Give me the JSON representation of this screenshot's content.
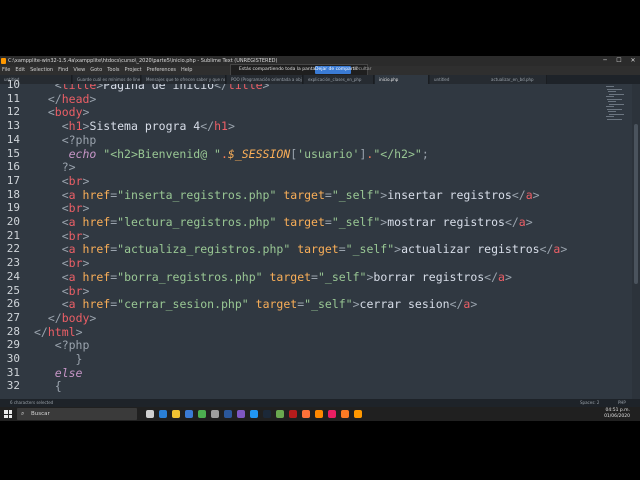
{
  "window": {
    "title": "C:\\xampplite-win32-1.5.4a\\xampplite\\htdocs\\curso\\_2020\\parte5\\inicio.php - Sublime Text (UNREGISTERED)",
    "menu": [
      "File",
      "Edit",
      "Selection",
      "Find",
      "View",
      "Goto",
      "Tools",
      "Project",
      "Preferences",
      "Help"
    ]
  },
  "share_banner": {
    "text": "Estás compartiendo toda la pantalla.",
    "button": "Dejar de compartir",
    "hide": "Ocultar"
  },
  "tabs": [
    {
      "label": "untitled",
      "active": false
    },
    {
      "label": "Guarde cuál es mínimos de línea",
      "active": false
    },
    {
      "label": "Mensajes que te ofrecen saber y que no hacen m",
      "active": false
    },
    {
      "label": "POO (Programación orientada a objetos)",
      "active": false
    },
    {
      "label": "explicación_clases_en_php",
      "active": false
    },
    {
      "label": "inicio.php",
      "active": true
    },
    {
      "label": "untitled",
      "active": false
    },
    {
      "label": "",
      "active": false
    },
    {
      "label": "actualizar_en_bd.php",
      "active": false
    }
  ],
  "editor": {
    "line_numbers": [
      "10",
      "11",
      "12",
      "13",
      "14",
      "15",
      "16",
      "17",
      "18",
      "19",
      "20",
      "21",
      "22",
      "23",
      "24",
      "25",
      "26",
      "27",
      "28",
      "29",
      "30",
      "31",
      "32"
    ],
    "lines": [
      [
        [
          "   ",
          ""
        ],
        [
          "<",
          "br"
        ],
        [
          "title",
          "tag"
        ],
        [
          ">",
          "br"
        ],
        [
          "Página de inicio",
          "txt"
        ],
        [
          "</",
          "br"
        ],
        [
          "title",
          "tag"
        ],
        [
          ">",
          "br"
        ]
      ],
      [
        [
          "  ",
          ""
        ],
        [
          "</",
          "br"
        ],
        [
          "head",
          "tag"
        ],
        [
          ">",
          "br"
        ]
      ],
      [
        [
          "  ",
          ""
        ],
        [
          "<",
          "br"
        ],
        [
          "body",
          "tag"
        ],
        [
          ">",
          "br"
        ]
      ],
      [
        [
          "    ",
          ""
        ],
        [
          "<",
          "br"
        ],
        [
          "h1",
          "tag"
        ],
        [
          ">",
          "br"
        ],
        [
          "Sistema progra 4",
          "txt"
        ],
        [
          "</",
          "br"
        ],
        [
          "h1",
          "tag"
        ],
        [
          ">",
          "br"
        ]
      ],
      [
        [
          "    ",
          ""
        ],
        [
          "<?php",
          "br"
        ]
      ],
      [
        [
          "     ",
          ""
        ],
        [
          "echo",
          "kw"
        ],
        [
          " ",
          ""
        ],
        [
          "\"<h2>Bienvenid@ \"",
          "str"
        ],
        [
          ".",
          "op"
        ],
        [
          "$_SESSION",
          "var"
        ],
        [
          "[",
          "br"
        ],
        [
          "'usuario'",
          "str"
        ],
        [
          "]",
          "br"
        ],
        [
          ".",
          "op"
        ],
        [
          "\"</h2>\"",
          "str"
        ],
        [
          ";",
          "br"
        ]
      ],
      [
        [
          "    ",
          ""
        ],
        [
          "?>",
          "br"
        ]
      ],
      [
        [
          "    ",
          ""
        ],
        [
          "<",
          "br"
        ],
        [
          "br",
          "tag"
        ],
        [
          ">",
          "br"
        ]
      ],
      [
        [
          "    ",
          ""
        ],
        [
          "<",
          "br"
        ],
        [
          "a",
          "tag"
        ],
        [
          " ",
          ""
        ],
        [
          "href",
          "attr"
        ],
        [
          "=",
          "br"
        ],
        [
          "\"inserta_registros.php\"",
          "str"
        ],
        [
          " ",
          ""
        ],
        [
          "target",
          "attr"
        ],
        [
          "=",
          "br"
        ],
        [
          "\"_self\"",
          "str"
        ],
        [
          ">",
          "br"
        ],
        [
          "insertar registros",
          "txt"
        ],
        [
          "</",
          "br"
        ],
        [
          "a",
          "tag"
        ],
        [
          ">",
          "br"
        ]
      ],
      [
        [
          "    ",
          ""
        ],
        [
          "<",
          "br"
        ],
        [
          "br",
          "tag"
        ],
        [
          ">",
          "br"
        ]
      ],
      [
        [
          "    ",
          ""
        ],
        [
          "<",
          "br"
        ],
        [
          "a",
          "tag"
        ],
        [
          " ",
          ""
        ],
        [
          "href",
          "attr"
        ],
        [
          "=",
          "br"
        ],
        [
          "\"lectura_registros.php\"",
          "str"
        ],
        [
          " ",
          ""
        ],
        [
          "target",
          "attr"
        ],
        [
          "=",
          "br"
        ],
        [
          "\"_self\"",
          "str"
        ],
        [
          ">",
          "br"
        ],
        [
          "mostrar registros",
          "txt"
        ],
        [
          "</",
          "br"
        ],
        [
          "a",
          "tag"
        ],
        [
          ">",
          "br"
        ]
      ],
      [
        [
          "    ",
          ""
        ],
        [
          "<",
          "br"
        ],
        [
          "br",
          "tag"
        ],
        [
          ">",
          "br"
        ]
      ],
      [
        [
          "    ",
          ""
        ],
        [
          "<",
          "br"
        ],
        [
          "a",
          "tag"
        ],
        [
          " ",
          ""
        ],
        [
          "href",
          "attr"
        ],
        [
          "=",
          "br"
        ],
        [
          "\"actualiza_registros.php\"",
          "str"
        ],
        [
          " ",
          ""
        ],
        [
          "target",
          "attr"
        ],
        [
          "=",
          "br"
        ],
        [
          "\"_self\"",
          "str"
        ],
        [
          ">",
          "br"
        ],
        [
          "actualizar registros",
          "txt"
        ],
        [
          "</",
          "br"
        ],
        [
          "a",
          "tag"
        ],
        [
          ">",
          "br"
        ]
      ],
      [
        [
          "    ",
          ""
        ],
        [
          "<",
          "br"
        ],
        [
          "br",
          "tag"
        ],
        [
          ">",
          "br"
        ]
      ],
      [
        [
          "    ",
          ""
        ],
        [
          "<",
          "br"
        ],
        [
          "a",
          "tag"
        ],
        [
          " ",
          ""
        ],
        [
          "href",
          "attr"
        ],
        [
          "=",
          "br"
        ],
        [
          "\"borra_registros.php\"",
          "str"
        ],
        [
          " ",
          ""
        ],
        [
          "target",
          "attr"
        ],
        [
          "=",
          "br"
        ],
        [
          "\"_self\"",
          "str"
        ],
        [
          ">",
          "br"
        ],
        [
          "borrar registros",
          "txt"
        ],
        [
          "</",
          "br"
        ],
        [
          "a",
          "tag"
        ],
        [
          ">",
          "br"
        ]
      ],
      [
        [
          "    ",
          ""
        ],
        [
          "<",
          "br"
        ],
        [
          "br",
          "tag"
        ],
        [
          ">",
          "br"
        ]
      ],
      [
        [
          "    ",
          ""
        ],
        [
          "<",
          "br"
        ],
        [
          "a",
          "tag"
        ],
        [
          " ",
          ""
        ],
        [
          "href",
          "attr"
        ],
        [
          "=",
          "br"
        ],
        [
          "\"cerrar_sesion.php\"",
          "str"
        ],
        [
          " ",
          ""
        ],
        [
          "target",
          "attr"
        ],
        [
          "=",
          "br"
        ],
        [
          "\"_self\"",
          "str"
        ],
        [
          ">",
          "br"
        ],
        [
          "cerrar sesion",
          "txt"
        ],
        [
          "</",
          "br"
        ],
        [
          "a",
          "tag"
        ],
        [
          ">",
          "br"
        ]
      ],
      [
        [
          "  ",
          ""
        ],
        [
          "</",
          "br"
        ],
        [
          "body",
          "tag"
        ],
        [
          ">",
          "br"
        ]
      ],
      [
        [
          "",
          ""
        ],
        [
          "</",
          "br"
        ],
        [
          "html",
          "tag"
        ],
        [
          ">",
          "br"
        ]
      ],
      [
        [
          "   ",
          ""
        ],
        [
          "<?php",
          "br"
        ]
      ],
      [
        [
          "      ",
          ""
        ],
        [
          "}",
          "br"
        ]
      ],
      [
        [
          "   ",
          ""
        ],
        [
          "else",
          "kw"
        ]
      ],
      [
        [
          "   ",
          ""
        ],
        [
          "{",
          "br"
        ]
      ]
    ]
  },
  "status": {
    "left": "6 characters selected",
    "spaces": "Spaces: 2",
    "syntax": "PHP"
  },
  "taskbar": {
    "search_placeholder": "Buscar",
    "time": "04:51 p.m.",
    "date": "01/06/2020",
    "icons": [
      "task-view",
      "edge",
      "file-explorer",
      "store",
      "chrome",
      "settings",
      "word",
      "visual-studio",
      "vscode",
      "steam",
      "notepad",
      "filezilla",
      "firefox",
      "vlc",
      "paint",
      "xampp",
      "sublime-text"
    ]
  },
  "colors": {
    "editor_bg": "#303841",
    "tag": "#ec5f66",
    "string": "#99c794",
    "attribute": "#f9ae58",
    "keyword": "#c695c6"
  }
}
